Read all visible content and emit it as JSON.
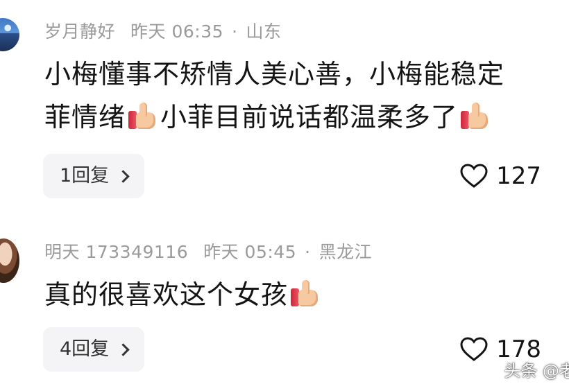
{
  "comments": [
    {
      "username": "岁月静好",
      "time": "昨天 06:35",
      "location": "山东",
      "separator": "·",
      "line1": "小梅懂事不矫情人美心善，小梅能稳定",
      "line2_a": "菲情绪",
      "line2_b": "小菲目前说话都温柔多了",
      "reply_label": "1回复",
      "like_count": "127",
      "emoji": "thumbs-up"
    },
    {
      "username": "明天 173349116",
      "time": "昨天 05:45",
      "location": "黑龙江",
      "separator": "·",
      "line1": "真的很喜欢这个女孩",
      "reply_label": "4回复",
      "like_count": "178",
      "emoji": "thumbs-up"
    }
  ],
  "watermark": "头条 @老",
  "icons": {
    "like": "heart-outline-icon",
    "reply_chevron": "chevron-right-icon"
  },
  "colors": {
    "meta_text": "#9a9a9a",
    "body_text": "#141414",
    "reply_bg": "#f4f4f6"
  }
}
